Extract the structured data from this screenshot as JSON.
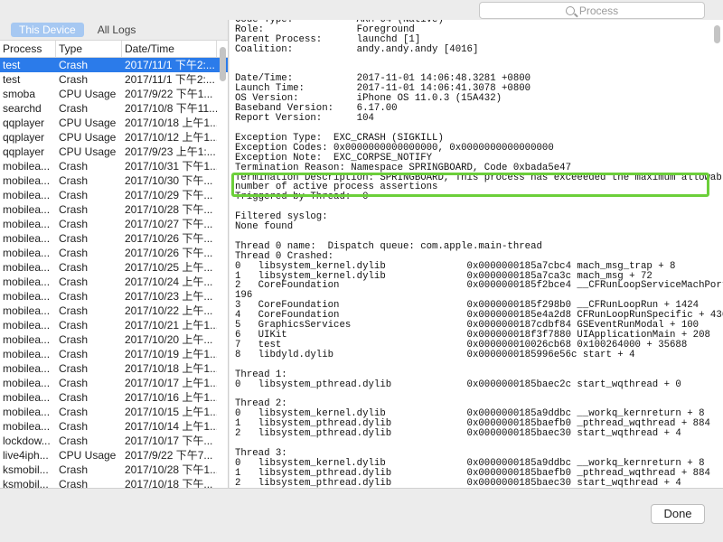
{
  "search": {
    "placeholder": "Process"
  },
  "tabs": [
    {
      "label": "This Device",
      "active": true
    },
    {
      "label": "All Logs",
      "active": false
    }
  ],
  "columns": [
    "Process",
    "Type",
    "Date/Time"
  ],
  "rows": [
    {
      "process": "test",
      "type": "Crash",
      "date": "2017/11/1 下午2:...",
      "selected": true
    },
    {
      "process": "test",
      "type": "Crash",
      "date": "2017/11/1 下午2:..."
    },
    {
      "process": "smoba",
      "type": "CPU Usage",
      "date": "2017/9/22 下午1..."
    },
    {
      "process": "searchd",
      "type": "Crash",
      "date": "2017/10/8 下午11..."
    },
    {
      "process": "qqplayer",
      "type": "CPU Usage",
      "date": "2017/10/18 上午1..."
    },
    {
      "process": "qqplayer",
      "type": "CPU Usage",
      "date": "2017/10/12 上午1..."
    },
    {
      "process": "qqplayer",
      "type": "CPU Usage",
      "date": "2017/9/23 上午1:..."
    },
    {
      "process": "mobilea...",
      "type": "Crash",
      "date": "2017/10/31 下午1..."
    },
    {
      "process": "mobilea...",
      "type": "Crash",
      "date": "2017/10/30 下午..."
    },
    {
      "process": "mobilea...",
      "type": "Crash",
      "date": "2017/10/29 下午..."
    },
    {
      "process": "mobilea...",
      "type": "Crash",
      "date": "2017/10/28 下午..."
    },
    {
      "process": "mobilea...",
      "type": "Crash",
      "date": "2017/10/27 下午..."
    },
    {
      "process": "mobilea...",
      "type": "Crash",
      "date": "2017/10/26 下午..."
    },
    {
      "process": "mobilea...",
      "type": "Crash",
      "date": "2017/10/26 下午..."
    },
    {
      "process": "mobilea...",
      "type": "Crash",
      "date": "2017/10/25 上午..."
    },
    {
      "process": "mobilea...",
      "type": "Crash",
      "date": "2017/10/24 上午..."
    },
    {
      "process": "mobilea...",
      "type": "Crash",
      "date": "2017/10/23 上午..."
    },
    {
      "process": "mobilea...",
      "type": "Crash",
      "date": "2017/10/22 上午..."
    },
    {
      "process": "mobilea...",
      "type": "Crash",
      "date": "2017/10/21 上午1..."
    },
    {
      "process": "mobilea...",
      "type": "Crash",
      "date": "2017/10/20 上午..."
    },
    {
      "process": "mobilea...",
      "type": "Crash",
      "date": "2017/10/19 上午1..."
    },
    {
      "process": "mobilea...",
      "type": "Crash",
      "date": "2017/10/18 上午1..."
    },
    {
      "process": "mobilea...",
      "type": "Crash",
      "date": "2017/10/17 上午1..."
    },
    {
      "process": "mobilea...",
      "type": "Crash",
      "date": "2017/10/16 上午1..."
    },
    {
      "process": "mobilea...",
      "type": "Crash",
      "date": "2017/10/15 上午1..."
    },
    {
      "process": "mobilea...",
      "type": "Crash",
      "date": "2017/10/14 上午1..."
    },
    {
      "process": "lockdow...",
      "type": "Crash",
      "date": "2017/10/17 下午..."
    },
    {
      "process": "live4iph...",
      "type": "CPU Usage",
      "date": "2017/9/22 下午7..."
    },
    {
      "process": "ksmobil...",
      "type": "Crash",
      "date": "2017/10/28 下午1..."
    },
    {
      "process": "ksmobil...",
      "type": "Crash",
      "date": "2017/10/18 下午..."
    }
  ],
  "log_text": "Code Type:           ARM-64 (Native)\nRole:                Foreground\nParent Process:      launchd [1]\nCoalition:           andy.andy.andy [4016]\n\n\nDate/Time:           2017-11-01 14:06:48.3281 +0800\nLaunch Time:         2017-11-01 14:06:41.3078 +0800\nOS Version:          iPhone OS 11.0.3 (15A432)\nBaseband Version:    6.17.00\nReport Version:      104\n\nException Type:  EXC_CRASH (SIGKILL)\nException Codes: 0x0000000000000000, 0x0000000000000000\nException Note:  EXC_CORPSE_NOTIFY\nTermination Reason: Namespace SPRINGBOARD, Code 0xbada5e47\nTermination Description: SPRINGBOARD, This process has exceeeded the maximum allowable\nnumber of active process assertions\nTriggered by Thread:  0\n\nFiltered syslog:\nNone found\n\nThread 0 name:  Dispatch queue: com.apple.main-thread\nThread 0 Crashed:\n0   libsystem_kernel.dylib        \t0x0000000185a7cbc4 mach_msg_trap + 8\n1   libsystem_kernel.dylib        \t0x0000000185a7ca3c mach_msg + 72\n2   CoreFoundation                \t0x0000000185f2bce4 __CFRunLoopServiceMachPort +\n196\n3   CoreFoundation                \t0x0000000185f298b0 __CFRunLoopRun + 1424\n4   CoreFoundation                \t0x0000000185e4a2d8 CFRunLoopRunSpecific + 436\n5   GraphicsServices              \t0x0000000187cdbf84 GSEventRunModal + 100\n6   UIKit                         \t0x000000018f3f7880 UIApplicationMain + 208\n7   test                          \t0x000000010026cb68 0x100264000 + 35688\n8   libdyld.dylib                 \t0x0000000185996e56c start + 4\n\nThread 1:\n0   libsystem_pthread.dylib       \t0x0000000185baec2c start_wqthread + 0\n\nThread 2:\n0   libsystem_kernel.dylib        \t0x0000000185a9ddbc __workq_kernreturn + 8\n1   libsystem_pthread.dylib       \t0x0000000185baefb0 _pthread_wqthread + 884\n2   libsystem_pthread.dylib       \t0x0000000185baec30 start_wqthread + 4\n\nThread 3:\n0   libsystem_kernel.dylib        \t0x0000000185a9ddbc __workq_kernreturn + 8\n1   libsystem_pthread.dylib       \t0x0000000185baefb0 _pthread_wqthread + 884\n2   libsystem_pthread.dylib       \t0x0000000185baec30 start_wqthread + 4",
  "done_label": "Done",
  "colors": {
    "selection": "#2b7bea",
    "highlight": "#6ccf3a",
    "tab_active": "#a6c8f2"
  },
  "icons": {
    "search": "search-icon"
  }
}
